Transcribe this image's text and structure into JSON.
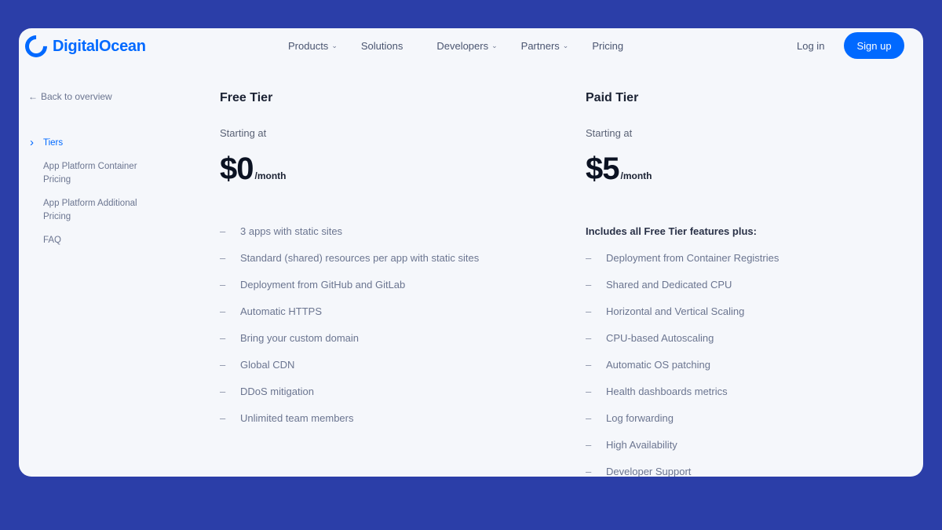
{
  "header": {
    "brand": "DigitalOcean",
    "nav": [
      {
        "label": "Products",
        "has_menu": true
      },
      {
        "label": "Solutions",
        "has_menu": false
      },
      {
        "label": "Developers",
        "has_menu": true
      },
      {
        "label": "Partners",
        "has_menu": true
      },
      {
        "label": "Pricing",
        "has_menu": false
      }
    ],
    "login": "Log in",
    "signup": "Sign up"
  },
  "sidebar": {
    "back": "Back to overview",
    "items": [
      {
        "label": "Tiers",
        "active": true
      },
      {
        "label": "App Platform Container Pricing",
        "active": false
      },
      {
        "label": "App Platform Additional Pricing",
        "active": false
      },
      {
        "label": "FAQ",
        "active": false
      }
    ]
  },
  "free": {
    "title": "Free Tier",
    "starting": "Starting at",
    "price": "$0",
    "per": "/month",
    "features": [
      "3 apps with static sites",
      "Standard (shared) resources per app with static sites",
      "Deployment from GitHub and GitLab",
      "Automatic HTTPS",
      "Bring your custom domain",
      "Global CDN",
      "DDoS mitigation",
      "Unlimited team members"
    ]
  },
  "paid": {
    "title": "Paid Tier",
    "starting": "Starting at",
    "price": "$5",
    "per": "/month",
    "lead": "Includes all Free Tier features plus:",
    "features": [
      "Deployment from Container Registries",
      "Shared and Dedicated CPU",
      "Horizontal and Vertical Scaling",
      "CPU-based Autoscaling",
      "Automatic OS patching",
      "Health dashboards metrics",
      "Log forwarding",
      "High Availability",
      "Developer Support"
    ]
  },
  "colors": {
    "accent": "#0069ff",
    "frame": "#2b3ea8",
    "page": "#f5f7fb"
  }
}
